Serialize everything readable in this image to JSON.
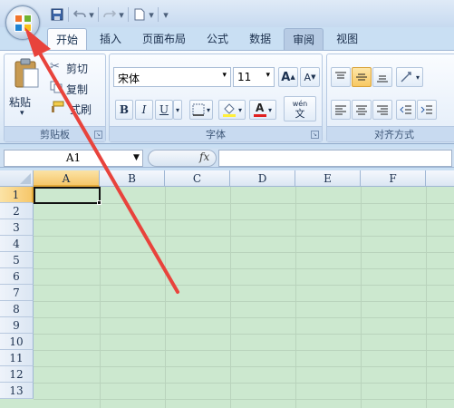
{
  "ribbon": {
    "tabs": [
      "开始",
      "插入",
      "页面布局",
      "公式",
      "数据",
      "审阅",
      "视图"
    ],
    "active_tab_index": 0,
    "groups": {
      "clipboard": {
        "label": "剪贴板",
        "paste": "粘贴",
        "cut": "剪切",
        "copy": "复制",
        "format_painter": "格式刷",
        "format_painter_visible": "式刷"
      },
      "font": {
        "label": "字体",
        "font_name": "宋体",
        "font_size": "11",
        "bold": "B",
        "italic": "I",
        "underline": "U",
        "grow": "A",
        "shrink": "A",
        "font_color_glyph": "A",
        "phonetic_top": "wén",
        "phonetic_bottom": "文"
      },
      "alignment": {
        "label": "对齐方式"
      }
    }
  },
  "formula_bar": {
    "name_box": "A1",
    "fx": "fx",
    "formula": ""
  },
  "sheet": {
    "columns": [
      "A",
      "B",
      "C",
      "D",
      "E",
      "F"
    ],
    "rows": [
      "1",
      "2",
      "3",
      "4",
      "5",
      "6",
      "7",
      "8",
      "9",
      "10",
      "11",
      "12",
      "13"
    ],
    "active_cell": "A1"
  },
  "colors": {
    "grid_background": "#cce8cf",
    "arrow": "#e8433c",
    "ribbon": "#dbe8f6"
  }
}
